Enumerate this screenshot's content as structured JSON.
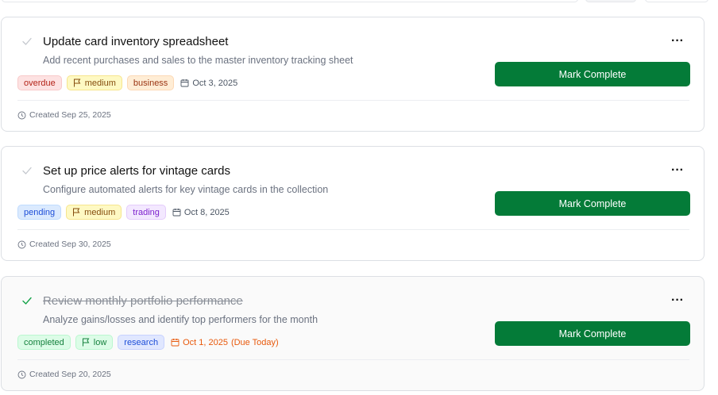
{
  "colors": {
    "primary_button": "#047b38",
    "overdue": "#fde2e2",
    "pending": "#dbeafe",
    "completed": "#dcfce7",
    "medium": "#fef9c3",
    "low": "#dcfce7",
    "business": "#ffedd5",
    "trading": "#f3e8ff",
    "research": "#e0e7ff",
    "due_today": "#e8590c"
  },
  "tasks": [
    {
      "title": "Update card inventory spreadsheet",
      "description": "Add recent purchases and sales to the master inventory tracking sheet",
      "status": "overdue",
      "priority": "medium",
      "category": "business",
      "due_date": "Oct 3, 2025",
      "created": "Created Sep 25, 2025",
      "action_label": "Mark Complete",
      "more_icon": "more-horizontal-icon",
      "check_icon": "check-icon"
    },
    {
      "title": "Set up price alerts for vintage cards",
      "description": "Configure automated alerts for key vintage cards in the collection",
      "status": "pending",
      "priority": "medium",
      "category": "trading",
      "due_date": "Oct 8, 2025",
      "created": "Created Sep 30, 2025",
      "action_label": "Mark Complete",
      "more_icon": "more-horizontal-icon",
      "check_icon": "check-icon"
    },
    {
      "title": "Review monthly portfolio performance",
      "description": "Analyze gains/losses and identify top performers for the month",
      "status": "completed",
      "priority": "low",
      "category": "research",
      "due_date": "Oct 1, 2025",
      "due_note": "(Due Today)",
      "created": "Created Sep 20, 2025",
      "action_label": "Mark Complete",
      "more_icon": "more-horizontal-icon",
      "check_icon": "check-icon"
    }
  ]
}
